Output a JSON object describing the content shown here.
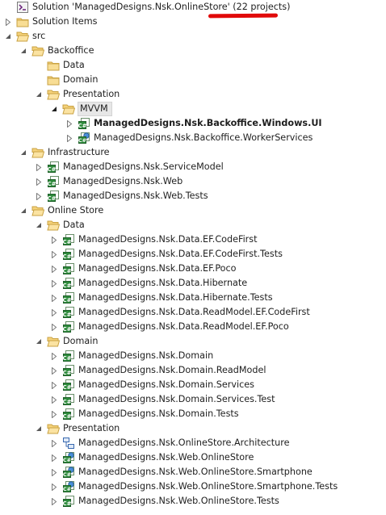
{
  "tree": [
    {
      "label": "Solution 'ManagedDesigns.Nsk.OnlineStore' (22 projects)",
      "level": 0,
      "icon": "solution-icon",
      "arrow": "none",
      "name": "solution-root"
    },
    {
      "label": "Solution Items",
      "level": 0,
      "icon": "folder-icon",
      "arrow": "collapsed",
      "name": "solution-items-folder"
    },
    {
      "label": "src",
      "level": 0,
      "icon": "folder-open-icon",
      "arrow": "expanded",
      "name": "src-folder"
    },
    {
      "label": "Backoffice",
      "level": 1,
      "icon": "folder-open-icon",
      "arrow": "expanded",
      "name": "backoffice-folder"
    },
    {
      "label": "Data",
      "level": 2,
      "icon": "folder-icon",
      "arrow": "none",
      "name": "backoffice-data-folder"
    },
    {
      "label": "Domain",
      "level": 2,
      "icon": "folder-icon",
      "arrow": "none",
      "name": "backoffice-domain-folder"
    },
    {
      "label": "Presentation",
      "level": 2,
      "icon": "folder-open-icon",
      "arrow": "expanded",
      "name": "backoffice-presentation-folder"
    },
    {
      "label": "MVVM",
      "level": 3,
      "icon": "folder-open-icon",
      "arrow": "expanded-dark",
      "name": "mvvm-folder",
      "selected": true
    },
    {
      "label": "ManagedDesigns.Nsk.Backoffice.Windows.UI",
      "level": 4,
      "icon": "csharp-project-icon",
      "arrow": "collapsed",
      "name": "project-backoffice-windows-ui",
      "bold": true
    },
    {
      "label": "ManagedDesigns.Nsk.Backoffice.WorkerServices",
      "level": 4,
      "icon": "csharp-web-project-icon",
      "arrow": "collapsed",
      "name": "project-backoffice-workerservices"
    },
    {
      "label": "Infrastructure",
      "level": 1,
      "icon": "folder-open-icon",
      "arrow": "expanded",
      "name": "infrastructure-folder"
    },
    {
      "label": "ManagedDesigns.Nsk.ServiceModel",
      "level": 2,
      "icon": "csharp-project-icon",
      "arrow": "collapsed",
      "name": "project-servicemodel"
    },
    {
      "label": "ManagedDesigns.Nsk.Web",
      "level": 2,
      "icon": "csharp-project-icon",
      "arrow": "collapsed",
      "name": "project-web"
    },
    {
      "label": "ManagedDesigns.Nsk.Web.Tests",
      "level": 2,
      "icon": "csharp-project-icon",
      "arrow": "collapsed",
      "name": "project-web-tests"
    },
    {
      "label": "Online Store",
      "level": 1,
      "icon": "folder-open-icon",
      "arrow": "expanded",
      "name": "online-store-folder"
    },
    {
      "label": "Data",
      "level": 2,
      "icon": "folder-open-icon",
      "arrow": "expanded",
      "name": "onlinestore-data-folder"
    },
    {
      "label": "ManagedDesigns.Nsk.Data.EF.CodeFirst",
      "level": 3,
      "icon": "csharp-project-icon",
      "arrow": "collapsed",
      "name": "project-data-ef-codefirst"
    },
    {
      "label": "ManagedDesigns.Nsk.Data.EF.CodeFirst.Tests",
      "level": 3,
      "icon": "csharp-project-icon",
      "arrow": "collapsed",
      "name": "project-data-ef-codefirst-tests"
    },
    {
      "label": "ManagedDesigns.Nsk.Data.EF.Poco",
      "level": 3,
      "icon": "csharp-project-icon",
      "arrow": "collapsed",
      "name": "project-data-ef-poco"
    },
    {
      "label": "ManagedDesigns.Nsk.Data.Hibernate",
      "level": 3,
      "icon": "csharp-project-icon",
      "arrow": "collapsed",
      "name": "project-data-hibernate"
    },
    {
      "label": "ManagedDesigns.Nsk.Data.Hibernate.Tests",
      "level": 3,
      "icon": "csharp-project-icon",
      "arrow": "collapsed",
      "name": "project-data-hibernate-tests"
    },
    {
      "label": "ManagedDesigns.Nsk.Data.ReadModel.EF.CodeFirst",
      "level": 3,
      "icon": "csharp-project-icon",
      "arrow": "collapsed",
      "name": "project-data-readmodel-ef-codefirst"
    },
    {
      "label": "ManagedDesigns.Nsk.Data.ReadModel.EF.Poco",
      "level": 3,
      "icon": "csharp-project-icon",
      "arrow": "collapsed",
      "name": "project-data-readmodel-ef-poco"
    },
    {
      "label": "Domain",
      "level": 2,
      "icon": "folder-open-icon",
      "arrow": "expanded",
      "name": "onlinestore-domain-folder"
    },
    {
      "label": "ManagedDesigns.Nsk.Domain",
      "level": 3,
      "icon": "csharp-project-icon",
      "arrow": "collapsed",
      "name": "project-domain"
    },
    {
      "label": "ManagedDesigns.Nsk.Domain.ReadModel",
      "level": 3,
      "icon": "csharp-project-icon",
      "arrow": "collapsed",
      "name": "project-domain-readmodel"
    },
    {
      "label": "ManagedDesigns.Nsk.Domain.Services",
      "level": 3,
      "icon": "csharp-project-icon",
      "arrow": "collapsed",
      "name": "project-domain-services"
    },
    {
      "label": "ManagedDesigns.Nsk.Domain.Services.Test",
      "level": 3,
      "icon": "csharp-project-icon",
      "arrow": "collapsed",
      "name": "project-domain-services-test"
    },
    {
      "label": "ManagedDesigns.Nsk.Domain.Tests",
      "level": 3,
      "icon": "csharp-project-icon",
      "arrow": "collapsed",
      "name": "project-domain-tests"
    },
    {
      "label": "Presentation",
      "level": 2,
      "icon": "folder-open-icon",
      "arrow": "expanded",
      "name": "onlinestore-presentation-folder"
    },
    {
      "label": "ManagedDesigns.Nsk.OnlineStore.Architecture",
      "level": 3,
      "icon": "modeling-project-icon",
      "arrow": "collapsed",
      "name": "project-onlinestore-architecture"
    },
    {
      "label": "ManagedDesigns.Nsk.Web.OnlineStore",
      "level": 3,
      "icon": "csharp-web-project-icon",
      "arrow": "collapsed",
      "name": "project-web-onlinestore"
    },
    {
      "label": "ManagedDesigns.Nsk.Web.OnlineStore.Smartphone",
      "level": 3,
      "icon": "csharp-web-project-icon",
      "arrow": "collapsed",
      "name": "project-web-onlinestore-smartphone"
    },
    {
      "label": "ManagedDesigns.Nsk.Web.OnlineStore.Smartphone.Tests",
      "level": 3,
      "icon": "csharp-web-project-icon",
      "arrow": "collapsed",
      "name": "project-web-onlinestore-smartphone-tests"
    },
    {
      "label": "ManagedDesigns.Nsk.Web.OnlineStore.Tests",
      "level": 3,
      "icon": "csharp-project-icon",
      "arrow": "collapsed",
      "name": "project-web-onlinestore-tests"
    }
  ],
  "annotation": {
    "color": "#e10a0a"
  }
}
